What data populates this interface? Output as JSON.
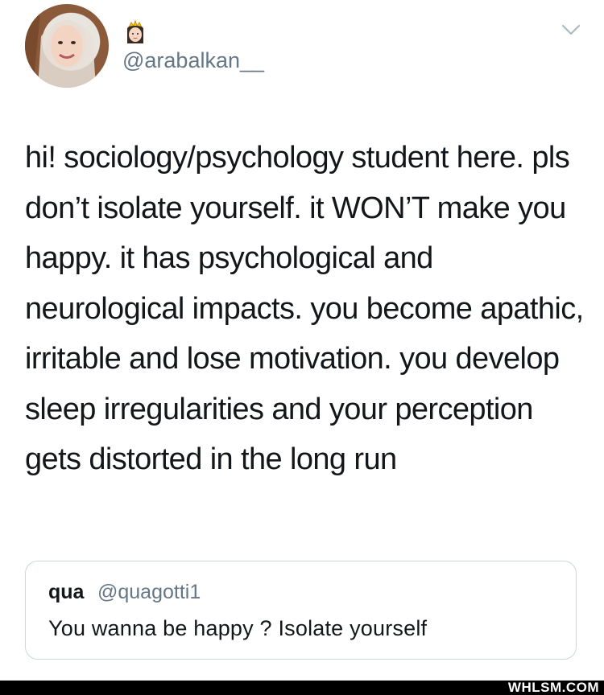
{
  "tweet": {
    "author_handle": "@arabalkan__",
    "badge_icon": "princess-emoji-icon",
    "text": "hi! sociology/psychology student here. pls don’t isolate yourself. it WON’T make you happy. it has psychological and neurological impacts. you become apathic, irritable and lose motivation. you develop sleep irregularities and your perception gets distorted in the long run"
  },
  "quoted_tweet": {
    "name": "qua",
    "handle": "@quagotti1",
    "text": "You wanna be happy ? Isolate yourself"
  },
  "watermark": "WHLSM.COM",
  "colors": {
    "text": "#14171a",
    "secondary": "#657786",
    "border": "#ccd6dd",
    "footer": "#000000"
  }
}
